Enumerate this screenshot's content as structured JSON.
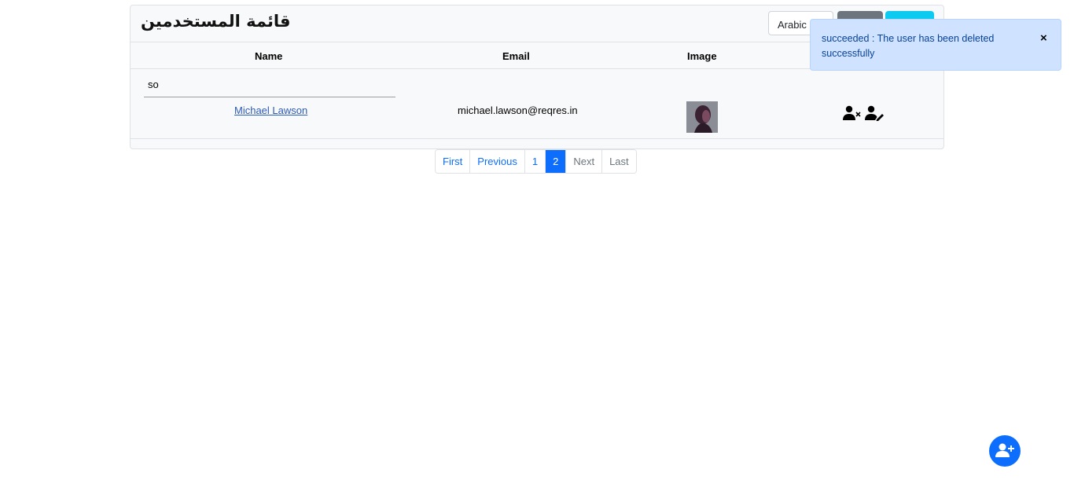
{
  "header": {
    "title": "قائمة المستخدمين",
    "language": "Arabic",
    "colors": {
      "gray_button": "#6c757d",
      "cyan_button": "#0dcaf0"
    }
  },
  "table": {
    "columns": [
      "Name",
      "Email",
      "Image"
    ],
    "search_value": "so",
    "rows": [
      {
        "name": "Michael Lawson",
        "email": "michael.lawson@reqres.in",
        "image": "avatar-icon",
        "actions": [
          "delete-user-icon",
          "edit-user-icon"
        ]
      }
    ]
  },
  "pagination": {
    "items": [
      "First",
      "Previous",
      "1",
      "2",
      "Next",
      "Last"
    ],
    "active": "2"
  },
  "toast": {
    "message": "succeeded : The user has been deleted successfully",
    "close": "×"
  },
  "fab": {
    "icon": "add-user-icon",
    "color": "#0d6efd"
  }
}
